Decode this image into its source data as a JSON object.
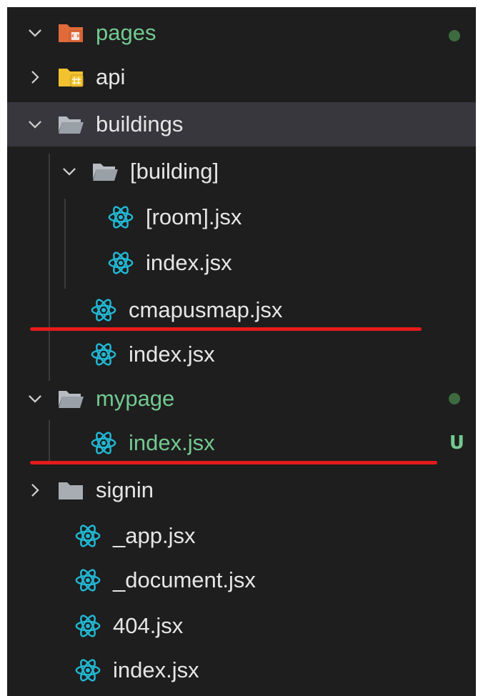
{
  "explorer": {
    "items": [
      {
        "label": "pages",
        "icon": "pages-folder-icon",
        "chevron": "open",
        "status": "modified-dot"
      },
      {
        "label": "api",
        "icon": "api-folder-icon",
        "chevron": "closed"
      },
      {
        "label": "buildings",
        "icon": "folder-open-icon",
        "chevron": "open"
      },
      {
        "label": "[building]",
        "icon": "folder-open-icon",
        "chevron": "open"
      },
      {
        "label": "[room].jsx",
        "icon": "react-icon"
      },
      {
        "label": "index.jsx",
        "icon": "react-icon"
      },
      {
        "label": "cmapusmap.jsx",
        "icon": "react-icon"
      },
      {
        "label": "index.jsx",
        "icon": "react-icon"
      },
      {
        "label": "mypage",
        "icon": "folder-open-icon",
        "chevron": "open",
        "status": "modified-dot"
      },
      {
        "label": "index.jsx",
        "icon": "react-icon",
        "status": "untracked",
        "status_letter": "U"
      },
      {
        "label": "signin",
        "icon": "folder-closed-icon",
        "chevron": "closed"
      },
      {
        "label": "_app.jsx",
        "icon": "react-icon"
      },
      {
        "label": "_document.jsx",
        "icon": "react-icon"
      },
      {
        "label": "404.jsx",
        "icon": "react-icon"
      },
      {
        "label": "index.jsx",
        "icon": "react-icon"
      }
    ]
  },
  "colors": {
    "background": "#1e1e1e",
    "selected_row": "#37373d",
    "git_green": "#73c991",
    "react_cyan": "#22b8d4",
    "annotation_red": "#e51a1a"
  }
}
